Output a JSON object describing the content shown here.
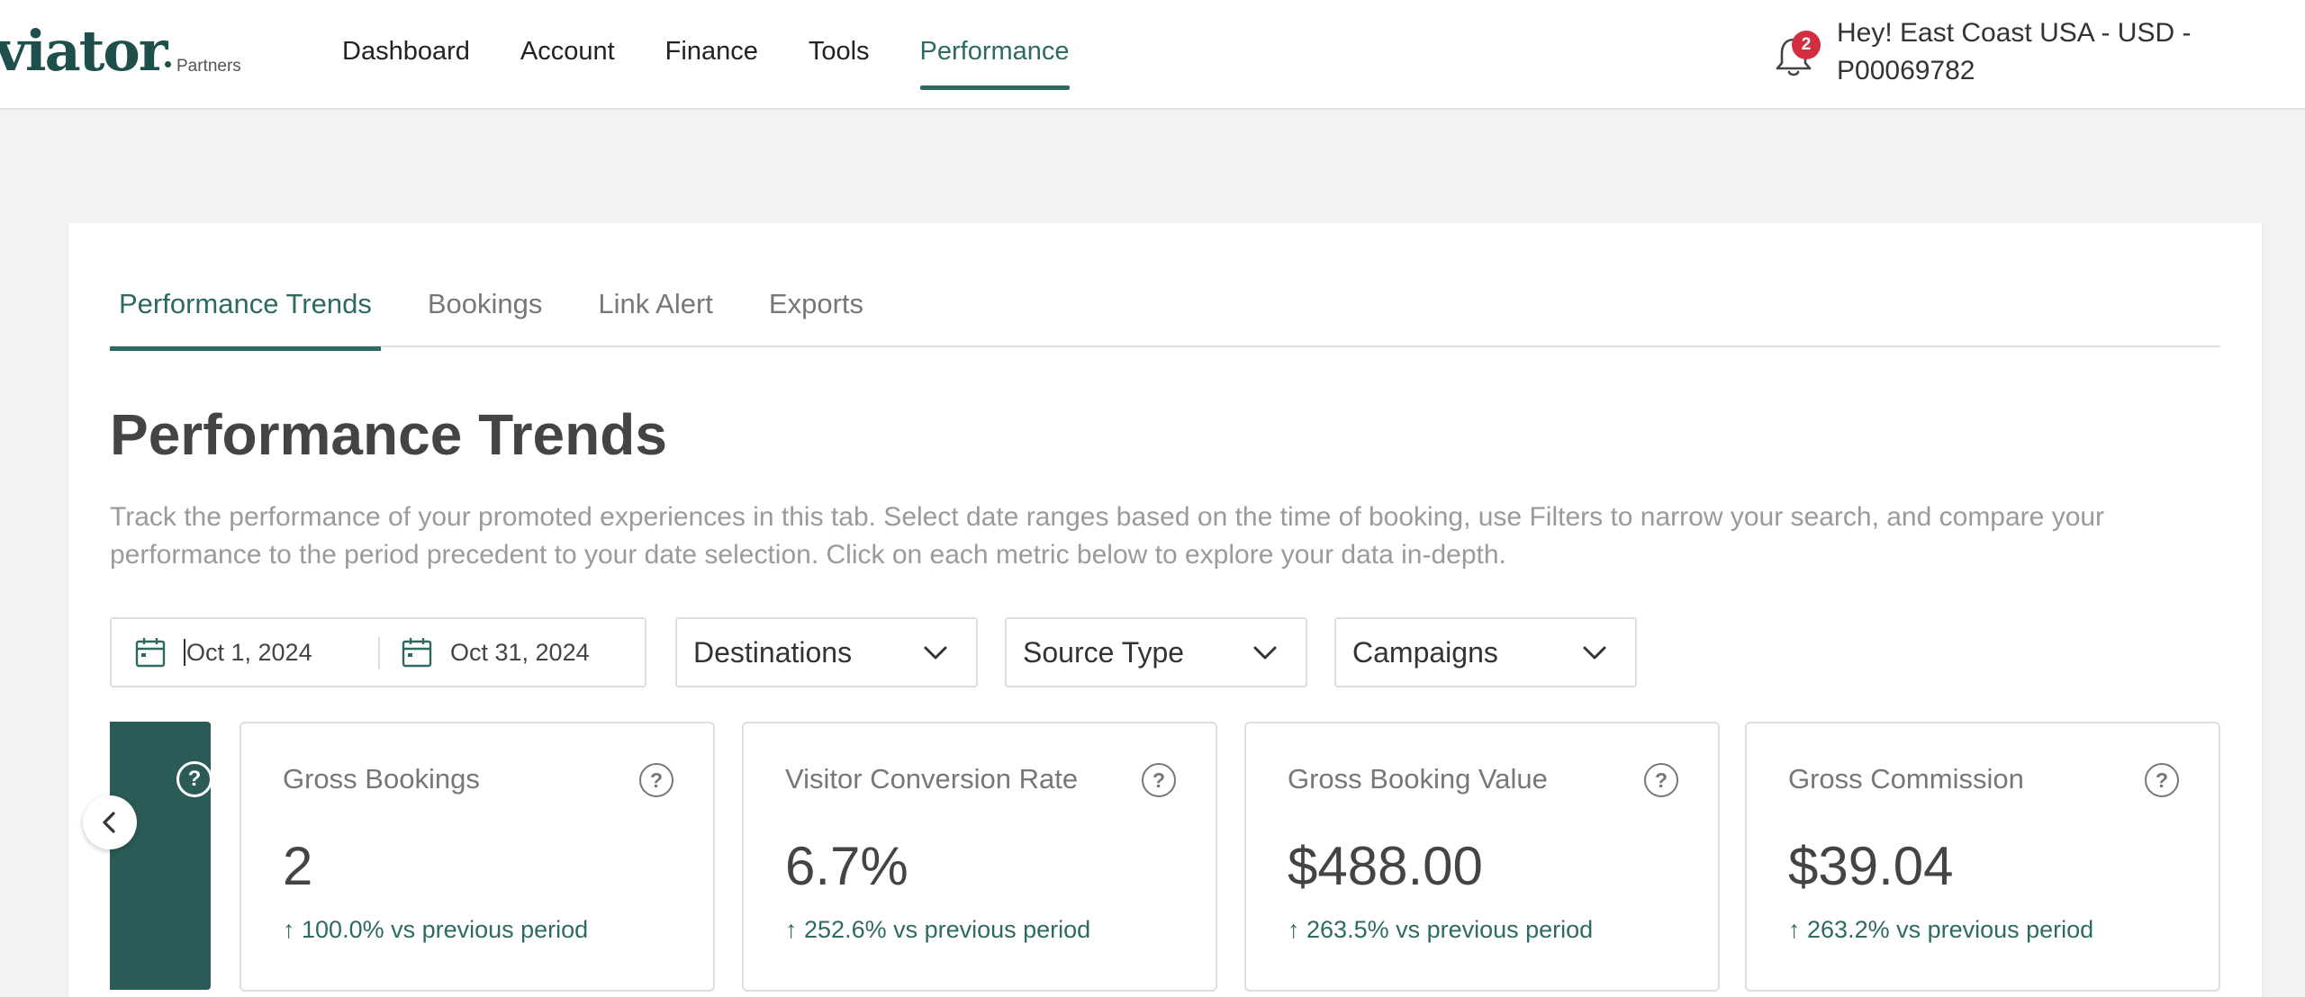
{
  "header": {
    "logo_text": "viator",
    "logo_subtitle": "Partners",
    "nav": [
      "Dashboard",
      "Account",
      "Finance",
      "Tools",
      "Performance"
    ],
    "active_nav": "Performance",
    "notification_count": "2",
    "account_line1": "Hey! East Coast USA - USD -",
    "account_line2": "P00069782"
  },
  "tabs": {
    "items": [
      "Performance Trends",
      "Bookings",
      "Link Alert",
      "Exports"
    ],
    "active": "Performance Trends"
  },
  "page": {
    "title": "Performance Trends",
    "description": "Track the performance of your promoted experiences in this tab. Select date ranges based on the time of booking, use Filters to narrow your search, and compare your performance to the period precedent to your date selection. Click on each metric below to explore your data in-depth."
  },
  "filters": {
    "start_date": "Oct 1, 2024",
    "end_date": "Oct 31, 2024",
    "destinations": "Destinations",
    "source_type": "Source Type",
    "campaigns": "Campaigns"
  },
  "metrics": [
    {
      "label": "Gross Bookings",
      "value": "2",
      "change": "100.0% vs previous period"
    },
    {
      "label": "Visitor Conversion Rate",
      "value": "6.7%",
      "change": "252.6% vs previous period"
    },
    {
      "label": "Gross Booking Value",
      "value": "$488.00",
      "change": "263.5% vs previous period"
    },
    {
      "label": "Gross Commission",
      "value": "$39.04",
      "change": "263.2% vs previous period"
    }
  ],
  "help_glyph": "?",
  "up_arrow": "↑",
  "colors": {
    "brand_teal": "#2d6a62",
    "dark_teal_card": "#2b5b57",
    "badge_red": "#d22e3f",
    "page_background": "#f2f2f2"
  },
  "icons": [
    "bell-icon",
    "calendar-icon",
    "chevron-down-icon",
    "chevron-left-icon",
    "help-icon",
    "arrow-up-icon"
  ]
}
